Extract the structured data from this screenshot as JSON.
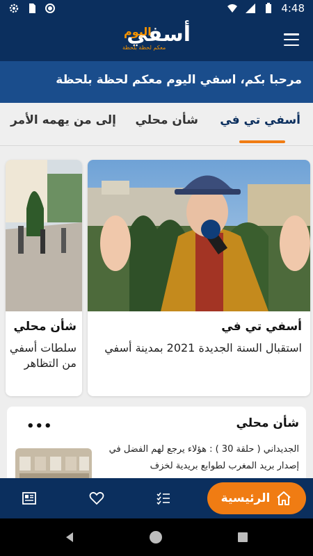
{
  "status_bar": {
    "time": "4:48"
  },
  "header": {
    "logo_text": "أسفي",
    "logo_accent": "اليوم",
    "logo_tagline": "معكم لحظة بلحظة"
  },
  "welcome": {
    "text": "مرحبا بكم، اسفي اليوم معكم لحظة بلحظة"
  },
  "tabs": [
    {
      "label": "أسفي تي في",
      "active": true
    },
    {
      "label": "شأن محلي",
      "active": false
    },
    {
      "label": "إلى من يهمه الأمر",
      "active": false
    }
  ],
  "featured": [
    {
      "category": "أسفي تي في",
      "title": "استقبال السنة الجديدة 2021 بمدينة أسفي"
    },
    {
      "category": "شأن محلي",
      "title": "سلطات أسفي من التظاهر"
    }
  ],
  "list_section": {
    "category": "شأن محلي",
    "more": "•••",
    "item_text": "الجديداني ( حلقة 30 ) : هؤلاء يرجع لهم الفضل في إصدار بريد المغرب لطوابع بريدية لخزف"
  },
  "bottom_nav": {
    "home_label": "الرئيسية"
  },
  "colors": {
    "primary": "#0b2f5e",
    "secondary": "#1a4d8c",
    "accent": "#f07c13"
  }
}
